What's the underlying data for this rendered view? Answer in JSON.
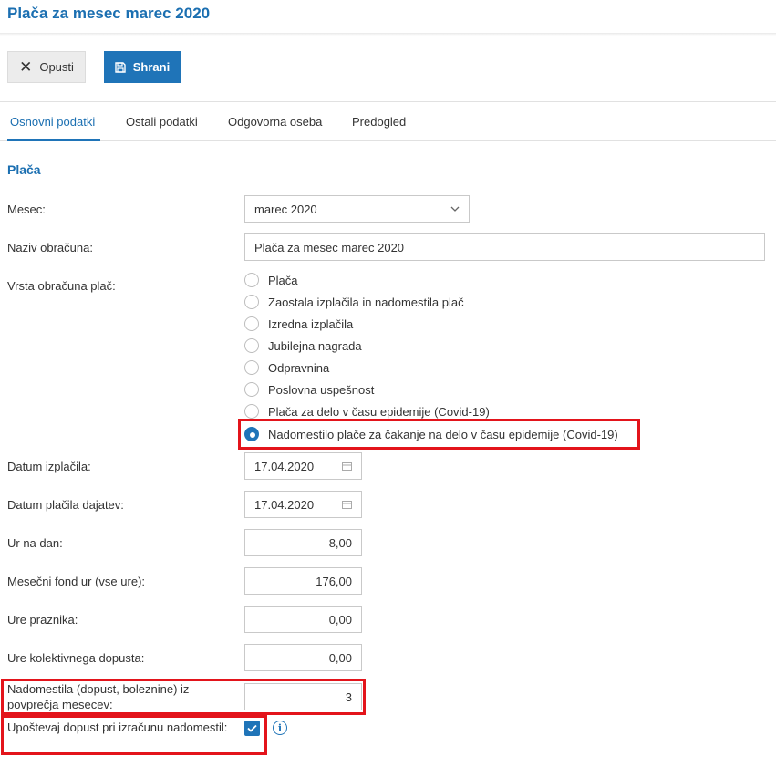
{
  "page": {
    "title": "Plača za mesec marec 2020"
  },
  "toolbar": {
    "cancel_label": "Opusti",
    "save_label": "Shrani"
  },
  "tabs": [
    {
      "label": "Osnovni podatki",
      "active": true
    },
    {
      "label": "Ostali podatki",
      "active": false
    },
    {
      "label": "Odgovorna oseba",
      "active": false
    },
    {
      "label": "Predogled",
      "active": false
    }
  ],
  "section": {
    "title": "Plača"
  },
  "form": {
    "month": {
      "label": "Mesec:",
      "value": "marec 2020"
    },
    "name": {
      "label": "Naziv obračuna:",
      "value": "Plača za mesec marec 2020"
    },
    "type": {
      "label": "Vrsta obračuna plač:",
      "options": [
        "Plača",
        "Zaostala izplačila in nadomestila plač",
        "Izredna izplačila",
        "Jubilejna nagrada",
        "Odpravnina",
        "Poslovna uspešnost",
        "Plača za delo v času epidemije (Covid-19)",
        "Nadomestilo plače za čakanje na delo v času epidemije (Covid-19)"
      ],
      "selected": "Nadomestilo plače za čakanje na delo v času epidemije (Covid-19)"
    },
    "payout_date": {
      "label": "Datum izplačila:",
      "value": "17.04.2020"
    },
    "tax_date": {
      "label": "Datum plačila dajatev:",
      "value": "17.04.2020"
    },
    "hours_per_day": {
      "label": "Ur na dan:",
      "value": "8,00"
    },
    "monthly_hours": {
      "label": "Mesečni fond ur (vse ure):",
      "value": "176,00"
    },
    "holiday_hours": {
      "label": "Ure praznika:",
      "value": "0,00"
    },
    "collective_leave": {
      "label": "Ure kolektivnega dopusta:",
      "value": "0,00"
    },
    "avg_months": {
      "label": "Nadomestila (dopust, boleznine) iz povprečja mesecev:",
      "value": "3"
    },
    "consider_leave": {
      "label": "Upoštevaj dopust pri izračunu nadomestil:",
      "checked": true
    }
  },
  "icons": {
    "close": "close-icon",
    "save": "floppy-disk-icon",
    "chevron": "chevron-down-icon",
    "calendar": "calendar-icon",
    "check": "checkmark-icon",
    "info": "info-icon"
  },
  "colors": {
    "accent": "#1f74b8",
    "highlight": "#e3141b"
  }
}
